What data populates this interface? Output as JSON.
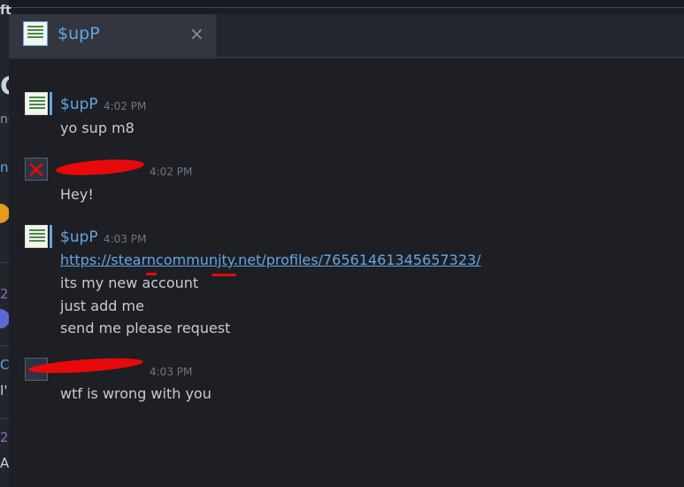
{
  "background": {
    "t1": "ft",
    "t2": "C",
    "t3": "ne",
    "t4": "n",
    "t5": "2",
    "t6": "C",
    "t7": "I'",
    "t8": "2",
    "t9": "A"
  },
  "tab": {
    "name": "$upP",
    "close_glyph": "×"
  },
  "messages": [
    {
      "author": "$upP",
      "time": "4:02 PM",
      "lines": [
        "yo sup m8"
      ]
    },
    {
      "author": "",
      "time": "4:02 PM",
      "lines": [
        "Hey!"
      ]
    },
    {
      "author": "$upP",
      "time": "4:03 PM",
      "link": "https://stearncommunjty.net/profiles/76561461345657323/",
      "lines": [
        "its my new account",
        "just add me",
        "send me please request"
      ]
    },
    {
      "author": "",
      "time": "4:03 PM",
      "lines": [
        "wtf is wrong with you"
      ]
    }
  ],
  "colors": {
    "accent": "#62a6e3",
    "redaction": "#e8090b",
    "background": "#1e1f24"
  }
}
